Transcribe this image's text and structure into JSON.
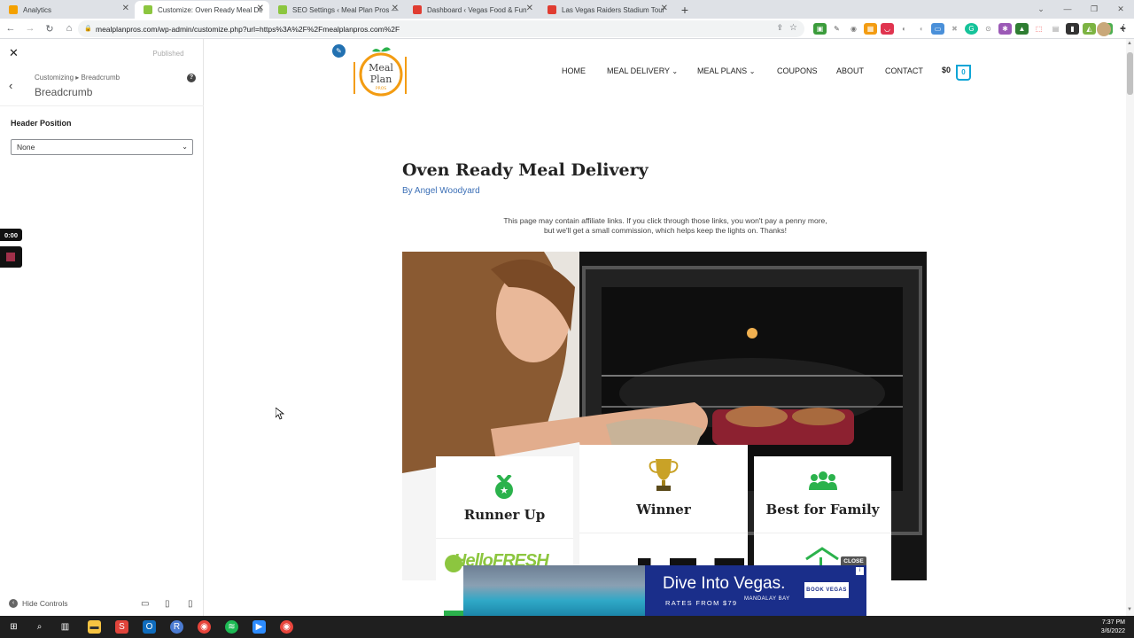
{
  "browser": {
    "tabs": [
      {
        "title": "Analytics",
        "color": "#f4a100",
        "active": false
      },
      {
        "title": "Customize: Oven Ready Meal De",
        "color": "#8cc63f",
        "active": true
      },
      {
        "title": "SEO Settings ‹ Meal Plan Pros —",
        "color": "#8cc63f",
        "active": false
      },
      {
        "title": "Dashboard ‹ Vegas Food & Fun",
        "color": "#e03c31",
        "active": false
      },
      {
        "title": "Las Vegas Raiders Stadium Tour",
        "color": "#e03c31",
        "active": false
      }
    ],
    "url": "mealplanpros.com/wp-admin/customize.php?url=https%3A%2F%2Fmealplanpros.com%2F"
  },
  "customizer": {
    "published_label": "Published",
    "breadcrumb": "Customizing ▸ Breadcrumb",
    "section_title": "Breadcrumb",
    "field_label": "Header Position",
    "field_value": "None",
    "hide_controls": "Hide Controls"
  },
  "recorder": {
    "time": "0:00"
  },
  "site": {
    "logo": {
      "line1": "Meal",
      "line2": "Plan",
      "line3": "PROS"
    },
    "nav": [
      {
        "label": "HOME"
      },
      {
        "label": "MEAL DELIVERY"
      },
      {
        "label": "MEAL PLANS"
      },
      {
        "label": "COUPONS"
      },
      {
        "label": "ABOUT"
      },
      {
        "label": "CONTACT"
      }
    ],
    "cart_total": "$0",
    "cart_count": "0",
    "title": "Oven Ready Meal Delivery",
    "author": "By Angel Woodyard",
    "affiliate_line1": "This page may contain affiliate links. If you click through those links, you won't pay a penny more,",
    "affiliate_line2": "but we'll get a small commission, which helps keep the lights on. Thanks!",
    "cards": [
      {
        "title": "Runner Up",
        "icon": "medal-icon",
        "brand": "HelloFRESH"
      },
      {
        "title": "Winner",
        "icon": "trophy-icon",
        "brand": ""
      },
      {
        "title": "Best for Family",
        "icon": "users-icon",
        "brand": ""
      }
    ],
    "accent": "#2bb24c"
  },
  "ad": {
    "close": "CLOSE",
    "headline": "Dive Into Vegas.",
    "subline": "RATES FROM $79",
    "brand": "MANDALAY BAY",
    "cta": "BOOK VEGAS"
  },
  "taskbar": {
    "time": "7:37 PM",
    "date": "3/6/2022"
  }
}
